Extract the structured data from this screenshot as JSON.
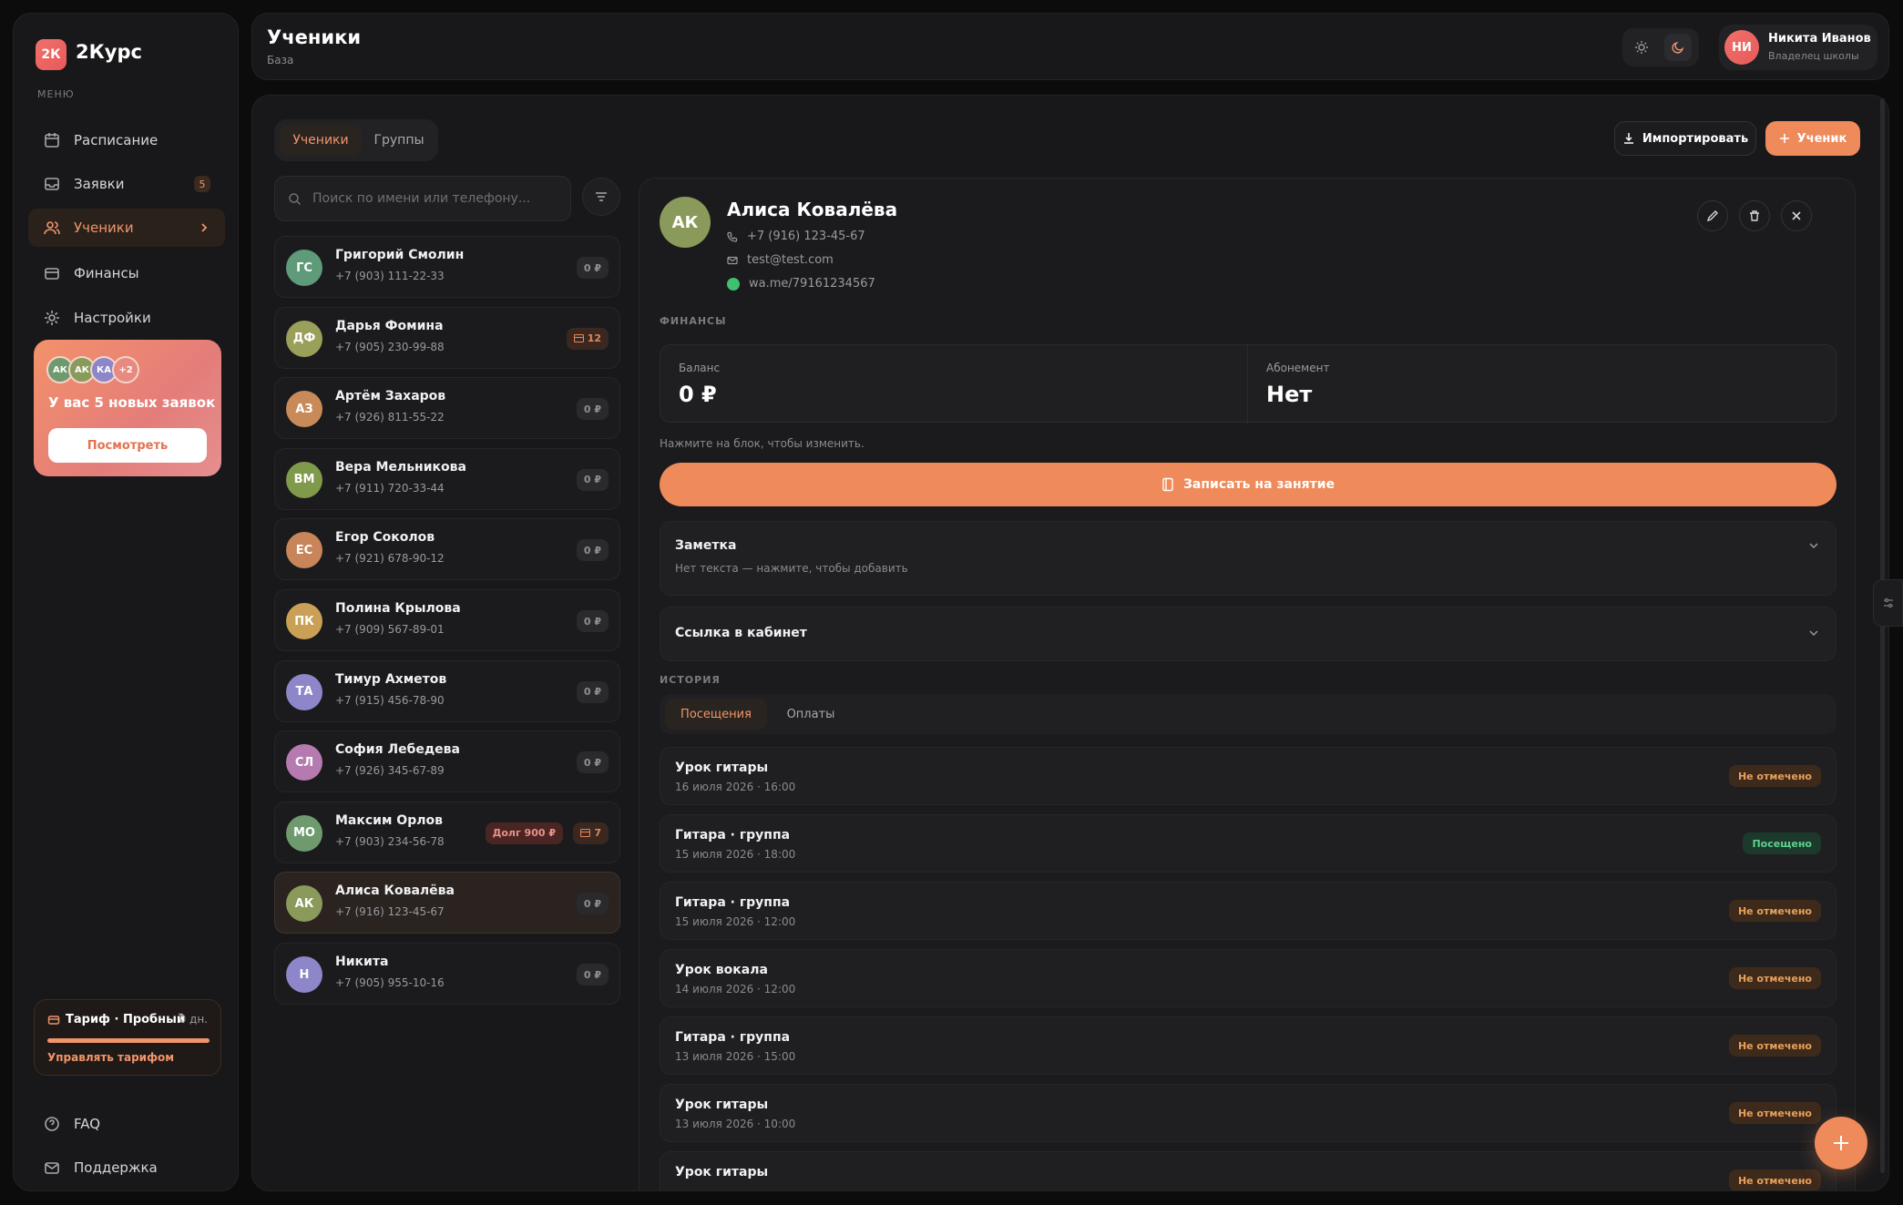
{
  "brand": {
    "logo_initials": "2К",
    "name": "2Курс"
  },
  "sidebar": {
    "menu_label": "МЕНЮ",
    "items": [
      {
        "label": "Расписание",
        "icon": "calendar-icon"
      },
      {
        "label": "Заявки",
        "icon": "inbox-icon",
        "badge": "5"
      },
      {
        "label": "Ученики",
        "icon": "users-icon",
        "active": true
      },
      {
        "label": "Финансы",
        "icon": "wallet-icon"
      },
      {
        "label": "Настройки",
        "icon": "gear-icon"
      }
    ],
    "promo": {
      "avatars": [
        "АК",
        "АК",
        "КА",
        "+2"
      ],
      "text": "У вас 5 новых заявок",
      "button": "Посмотреть"
    },
    "tariff": {
      "title": "Тариф · Пробный",
      "days": "0 дн.",
      "link": "Управлять тарифом"
    },
    "footer": [
      {
        "label": "FAQ",
        "icon": "help-icon"
      },
      {
        "label": "Поддержка",
        "icon": "mail-icon"
      }
    ]
  },
  "header": {
    "title": "Ученики",
    "subtitle": "База",
    "user": {
      "initials": "НИ",
      "name": "Никита Иванов",
      "role": "Владелец школы"
    }
  },
  "main": {
    "tabs": [
      "Ученики",
      "Группы"
    ],
    "import_label": "Импортировать",
    "add_label": "Ученик",
    "search_placeholder": "Поиск по имени или телефону..."
  },
  "students": [
    {
      "initials": "ГС",
      "name": "Григорий Смолин",
      "phone": "+7 (903) 111-22-33",
      "color": "#5f9a7a",
      "pills": [
        {
          "type": "zero",
          "text": "0 ₽"
        }
      ]
    },
    {
      "initials": "ДФ",
      "name": "Дарья Фомина",
      "phone": "+7 (905) 230-99-88",
      "color": "#9aa05a",
      "pills": [
        {
          "type": "tk",
          "text": "12"
        }
      ]
    },
    {
      "initials": "АЗ",
      "name": "Артём Захаров",
      "phone": "+7 (926) 811-55-22",
      "color": "#c98a5a",
      "pills": [
        {
          "type": "zero",
          "text": "0 ₽"
        }
      ]
    },
    {
      "initials": "ВМ",
      "name": "Вера Мельникова",
      "phone": "+7 (911) 720-33-44",
      "color": "#7f9a4a",
      "pills": [
        {
          "type": "zero",
          "text": "0 ₽"
        }
      ]
    },
    {
      "initials": "ЕС",
      "name": "Егор Соколов",
      "phone": "+7 (921) 678-90-12",
      "color": "#c8855a",
      "pills": [
        {
          "type": "zero",
          "text": "0 ₽"
        }
      ]
    },
    {
      "initials": "ПК",
      "name": "Полина Крылова",
      "phone": "+7 (909) 567-89-01",
      "color": "#c9a055",
      "pills": [
        {
          "type": "zero",
          "text": "0 ₽"
        }
      ]
    },
    {
      "initials": "ТА",
      "name": "Тимур Ахметов",
      "phone": "+7 (915) 456-78-90",
      "color": "#8d86c9",
      "pills": [
        {
          "type": "zero",
          "text": "0 ₽"
        }
      ]
    },
    {
      "initials": "СЛ",
      "name": "София Лебедева",
      "phone": "+7 (926) 345-67-89",
      "color": "#b57ab0",
      "pills": [
        {
          "type": "zero",
          "text": "0 ₽"
        }
      ]
    },
    {
      "initials": "МО",
      "name": "Максим Орлов",
      "phone": "+7 (903) 234-56-78",
      "color": "#6e9a6e",
      "pills": [
        {
          "type": "debt",
          "text": "Долг 900 ₽"
        },
        {
          "type": "tk",
          "text": "7"
        }
      ]
    },
    {
      "initials": "АК",
      "name": "Алиса Ковалёва",
      "phone": "+7 (916) 123-45-67",
      "color": "#8a9a5a",
      "selected": true,
      "pills": [
        {
          "type": "zero",
          "text": "0 ₽"
        }
      ]
    },
    {
      "initials": "Н",
      "name": "Никита",
      "phone": "+7 (905) 955-10-16",
      "color": "#8d86c9",
      "pills": [
        {
          "type": "zero",
          "text": "0 ₽"
        }
      ]
    }
  ],
  "detail": {
    "initials": "АК",
    "name": "Алиса Ковалёва",
    "phone": "+7 (916) 123-45-67",
    "email": "test@test.com",
    "whatsapp": "wa.me/79161234567",
    "finance_label": "ФИНАНСЫ",
    "balance_label": "Баланс",
    "balance_value": "0 ₽",
    "subscription_label": "Абонемент",
    "subscription_value": "Нет",
    "hint": "Нажмите на блок, чтобы изменить.",
    "cta": "Записать на занятие",
    "note_title": "Заметка",
    "note_sub": "Нет текста — нажмите, чтобы добавить",
    "link_title": "Ссылка в кабинет",
    "history_label": "ИСТОРИЯ",
    "history_tabs": [
      "Посещения",
      "Оплаты"
    ],
    "history": [
      {
        "title": "Урок гитары",
        "date": "16 июля 2026 · 16:00",
        "status": "Не отмечено",
        "state": "no"
      },
      {
        "title": "Гитара · группа",
        "date": "15 июля 2026 · 18:00",
        "status": "Посещено",
        "state": "yes"
      },
      {
        "title": "Гитара · группа",
        "date": "15 июля 2026 · 12:00",
        "status": "Не отмечено",
        "state": "no"
      },
      {
        "title": "Урок вокала",
        "date": "14 июля 2026 · 12:00",
        "status": "Не отмечено",
        "state": "no"
      },
      {
        "title": "Гитара · группа",
        "date": "13 июля 2026 · 15:00",
        "status": "Не отмечено",
        "state": "no"
      },
      {
        "title": "Урок гитары",
        "date": "13 июля 2026 · 10:00",
        "status": "Не отмечено",
        "state": "no"
      },
      {
        "title": "Урок гитары",
        "date": "",
        "status": "Не отмечено",
        "state": "no"
      }
    ]
  }
}
